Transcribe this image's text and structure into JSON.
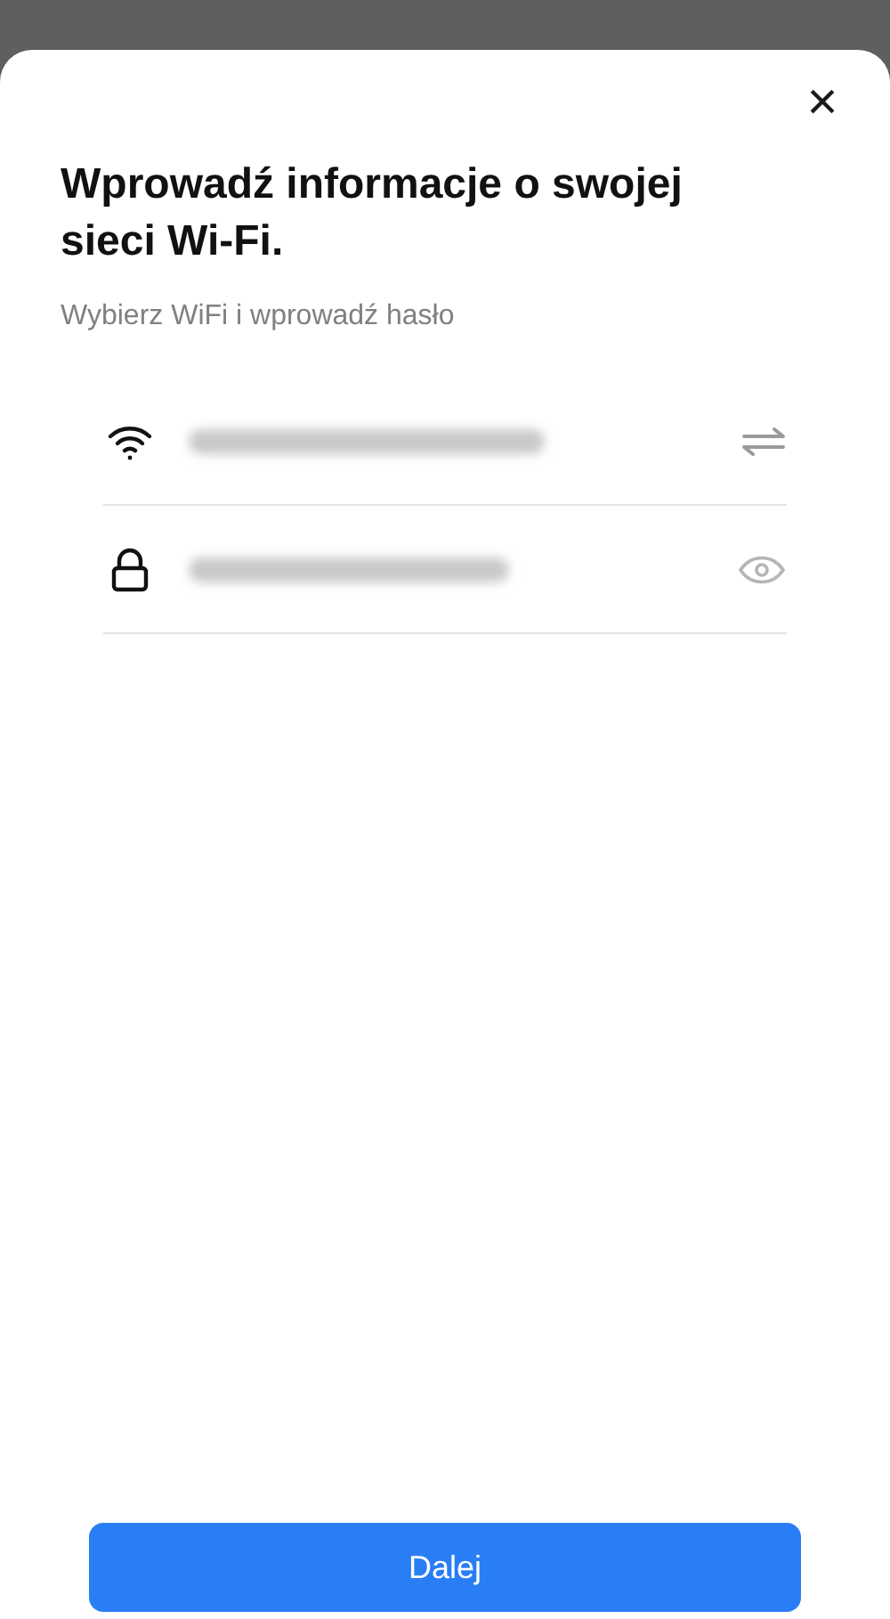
{
  "dialog": {
    "close": "×",
    "title": "Wprowadź informacje o swojej sieci Wi-Fi.",
    "subtitle": "Wybierz WiFi i wprowadź hasło"
  },
  "fields": [
    {
      "kind": "network"
    },
    {
      "kind": "password"
    }
  ],
  "button": "Dalej"
}
